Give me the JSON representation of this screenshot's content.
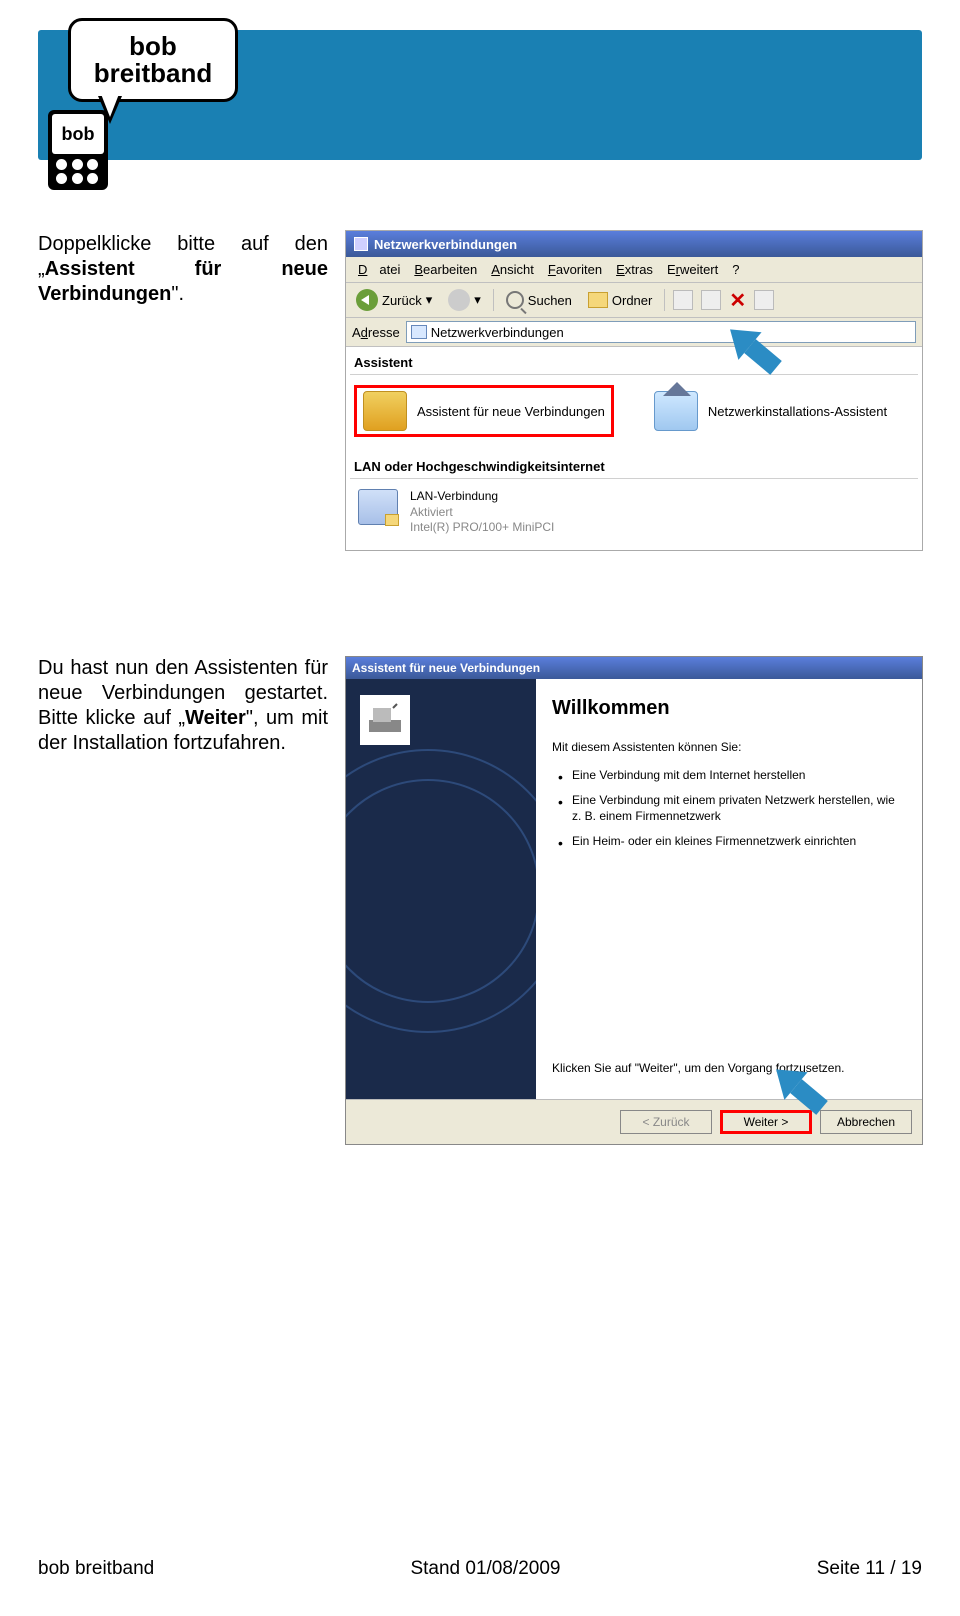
{
  "header": {
    "bubble_line1": "bob",
    "bubble_line2": "breitband",
    "phone_text": "bob"
  },
  "instr1": {
    "pre": "Doppelklicke bitte auf den „",
    "bold": "Assistent für neue Verbindungen",
    "post": "\"."
  },
  "instr2": {
    "line1": "Du hast nun den Assistenten für neue Verbindungen gestartet. Bitte klicke auf „",
    "bold": "Weiter",
    "post": "\", um mit der Installation fortzufahren."
  },
  "win1": {
    "title": "Netzwerkverbindungen",
    "menu": {
      "datei": "Datei",
      "bearbeiten": "Bearbeiten",
      "ansicht": "Ansicht",
      "favoriten": "Favoriten",
      "extras": "Extras",
      "erweitert": "Erweitert",
      "help": "?"
    },
    "toolbar": {
      "back": "Zurück",
      "suchen": "Suchen",
      "ordner": "Ordner"
    },
    "addr_label": "Adresse",
    "addr_value": "Netzwerkverbindungen",
    "sec_assistent": "Assistent",
    "item_a": "Assistent für neue Verbindungen",
    "item_b": "Netzwerkinstallations-Assistent",
    "sec_lan": "LAN oder Hochgeschwindigkeitsinternet",
    "lan_name": "LAN-Verbindung",
    "lan_status": "Aktiviert",
    "lan_dev": "Intel(R) PRO/100+ MiniPCI"
  },
  "win2": {
    "title": "Assistent für neue Verbindungen",
    "welcome": "Willkommen",
    "intro": "Mit diesem Assistenten können Sie:",
    "b1": "Eine Verbindung mit dem Internet herstellen",
    "b2": "Eine Verbindung mit einem privaten Netzwerk herstellen, wie z. B. einem Firmennetzwerk",
    "b3": "Ein Heim- oder ein kleines Firmennetzwerk einrichten",
    "cont": "Klicken Sie auf \"Weiter\", um den Vorgang fortzusetzen.",
    "btn_back": "< Zurück",
    "btn_next": "Weiter >",
    "btn_cancel": "Abbrechen"
  },
  "footer": {
    "left": "bob breitband",
    "center": "Stand 01/08/2009",
    "right": "Seite 11 / 19"
  }
}
